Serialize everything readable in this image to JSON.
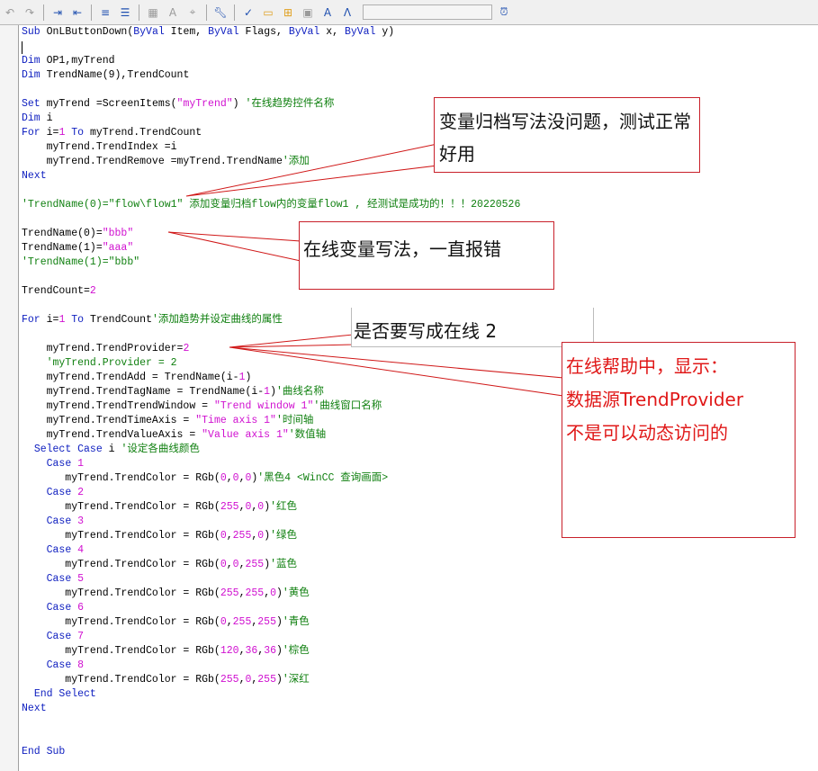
{
  "toolbar": {
    "icons": [
      "undo-icon",
      "redo-icon",
      "indent-icon",
      "outdent-icon",
      "align-icon",
      "comment-block-icon",
      "find-icon",
      "replace-icon",
      "goto-icon",
      "settings-icon",
      "check-syntax-icon",
      "folder-icon",
      "add-folder-icon",
      "tag-icon",
      "font-icon",
      "compass-icon",
      "clock-icon"
    ],
    "field_value": ""
  },
  "code": {
    "lines": [
      [
        [
          "k",
          "Sub"
        ],
        [
          "n",
          " OnLButtonDown("
        ],
        [
          "k",
          "ByVal"
        ],
        [
          "n",
          " Item, "
        ],
        [
          "k",
          "ByVal"
        ],
        [
          "n",
          " Flags, "
        ],
        [
          "k",
          "ByVal"
        ],
        [
          "n",
          " x, "
        ],
        [
          "k",
          "ByVal"
        ],
        [
          "n",
          " y)"
        ]
      ],
      [],
      [
        [
          "k",
          "Dim"
        ],
        [
          "n",
          " OP1,myTrend"
        ]
      ],
      [
        [
          "k",
          "Dim"
        ],
        [
          "n",
          " TrendName(9),TrendCount"
        ]
      ],
      [],
      [
        [
          "k",
          "Set"
        ],
        [
          "n",
          " myTrend =ScreenItems("
        ],
        [
          "s",
          "\"myTrend\""
        ],
        [
          "n",
          ") "
        ],
        [
          "c",
          "'在线趋势控件名称"
        ]
      ],
      [
        [
          "k",
          "Dim"
        ],
        [
          "n",
          " i"
        ]
      ],
      [
        [
          "k",
          "For"
        ],
        [
          "n",
          " i="
        ],
        [
          "s",
          "1"
        ],
        [
          "n",
          " "
        ],
        [
          "k",
          "To"
        ],
        [
          "n",
          " myTrend.TrendCount"
        ]
      ],
      [
        [
          "n",
          "    myTrend.TrendIndex =i"
        ]
      ],
      [
        [
          "n",
          "    myTrend.TrendRemove =myTrend.TrendName"
        ],
        [
          "c",
          "'添加"
        ]
      ],
      [
        [
          "k",
          "Next"
        ]
      ],
      [],
      [
        [
          "c",
          "'TrendName(0)=\"flow\\flow1\" 添加变量归档flow内的变量flow1 , 经测试是成功的！！！20220526"
        ]
      ],
      [],
      [
        [
          "n",
          "TrendName(0)="
        ],
        [
          "s",
          "\"bbb\""
        ]
      ],
      [
        [
          "n",
          "TrendName(1)="
        ],
        [
          "s",
          "\"aaa\""
        ]
      ],
      [
        [
          "c",
          "'TrendName(1)=\"bbb\""
        ]
      ],
      [],
      [
        [
          "n",
          "TrendCount="
        ],
        [
          "s",
          "2"
        ]
      ],
      [],
      [
        [
          "k",
          "For"
        ],
        [
          "n",
          " i="
        ],
        [
          "s",
          "1"
        ],
        [
          "n",
          " "
        ],
        [
          "k",
          "To"
        ],
        [
          "n",
          " TrendCount"
        ],
        [
          "c",
          "'添加趋势并设定曲线的属性"
        ]
      ],
      [],
      [
        [
          "n",
          "    myTrend.TrendProvider="
        ],
        [
          "s",
          "2"
        ]
      ],
      [
        [
          "c",
          "    'myTrend.Provider = 2"
        ]
      ],
      [
        [
          "n",
          "    myTrend.TrendAdd = TrendName(i-"
        ],
        [
          "s",
          "1"
        ],
        [
          "n",
          ")"
        ]
      ],
      [
        [
          "n",
          "    myTrend.TrendTagName = TrendName(i-"
        ],
        [
          "s",
          "1"
        ],
        [
          "n",
          ")"
        ],
        [
          "c",
          "'曲线名称"
        ]
      ],
      [
        [
          "n",
          "    myTrend.TrendTrendWindow = "
        ],
        [
          "s",
          "\"Trend window 1\""
        ],
        [
          "c",
          "'曲线窗口名称"
        ]
      ],
      [
        [
          "n",
          "    myTrend.TrendTimeAxis = "
        ],
        [
          "s",
          "\"Time axis 1\""
        ],
        [
          "c",
          "'时间轴"
        ]
      ],
      [
        [
          "n",
          "    myTrend.TrendValueAxis = "
        ],
        [
          "s",
          "\"Value axis 1\""
        ],
        [
          "c",
          "'数值轴"
        ]
      ],
      [
        [
          "n",
          "  "
        ],
        [
          "k",
          "Select Case"
        ],
        [
          "n",
          " i "
        ],
        [
          "c",
          "'设定各曲线颜色"
        ]
      ],
      [
        [
          "n",
          "    "
        ],
        [
          "k",
          "Case"
        ],
        [
          "n",
          " "
        ],
        [
          "s",
          "1"
        ]
      ],
      [
        [
          "n",
          "       myTrend.TrendColor = RGb("
        ],
        [
          "s",
          "0"
        ],
        [
          "n",
          ","
        ],
        [
          "s",
          "0"
        ],
        [
          "n",
          ","
        ],
        [
          "s",
          "0"
        ],
        [
          "n",
          ")"
        ],
        [
          "c",
          "'黑色4 <WinCC 查询画面>"
        ]
      ],
      [
        [
          "n",
          "    "
        ],
        [
          "k",
          "Case"
        ],
        [
          "n",
          " "
        ],
        [
          "s",
          "2"
        ]
      ],
      [
        [
          "n",
          "       myTrend.TrendColor = RGb("
        ],
        [
          "s",
          "255"
        ],
        [
          "n",
          ","
        ],
        [
          "s",
          "0"
        ],
        [
          "n",
          ","
        ],
        [
          "s",
          "0"
        ],
        [
          "n",
          ")"
        ],
        [
          "c",
          "'红色"
        ]
      ],
      [
        [
          "n",
          "    "
        ],
        [
          "k",
          "Case"
        ],
        [
          "n",
          " "
        ],
        [
          "s",
          "3"
        ]
      ],
      [
        [
          "n",
          "       myTrend.TrendColor = RGb("
        ],
        [
          "s",
          "0"
        ],
        [
          "n",
          ","
        ],
        [
          "s",
          "255"
        ],
        [
          "n",
          ","
        ],
        [
          "s",
          "0"
        ],
        [
          "n",
          ")"
        ],
        [
          "c",
          "'绿色"
        ]
      ],
      [
        [
          "n",
          "    "
        ],
        [
          "k",
          "Case"
        ],
        [
          "n",
          " "
        ],
        [
          "s",
          "4"
        ]
      ],
      [
        [
          "n",
          "       myTrend.TrendColor = RGb("
        ],
        [
          "s",
          "0"
        ],
        [
          "n",
          ","
        ],
        [
          "s",
          "0"
        ],
        [
          "n",
          ","
        ],
        [
          "s",
          "255"
        ],
        [
          "n",
          ")"
        ],
        [
          "c",
          "'蓝色"
        ]
      ],
      [
        [
          "n",
          "    "
        ],
        [
          "k",
          "Case"
        ],
        [
          "n",
          " "
        ],
        [
          "s",
          "5"
        ]
      ],
      [
        [
          "n",
          "       myTrend.TrendColor = RGb("
        ],
        [
          "s",
          "255"
        ],
        [
          "n",
          ","
        ],
        [
          "s",
          "255"
        ],
        [
          "n",
          ","
        ],
        [
          "s",
          "0"
        ],
        [
          "n",
          ")"
        ],
        [
          "c",
          "'黄色"
        ]
      ],
      [
        [
          "n",
          "    "
        ],
        [
          "k",
          "Case"
        ],
        [
          "n",
          " "
        ],
        [
          "s",
          "6"
        ]
      ],
      [
        [
          "n",
          "       myTrend.TrendColor = RGb("
        ],
        [
          "s",
          "0"
        ],
        [
          "n",
          ","
        ],
        [
          "s",
          "255"
        ],
        [
          "n",
          ","
        ],
        [
          "s",
          "255"
        ],
        [
          "n",
          ")"
        ],
        [
          "c",
          "'青色"
        ]
      ],
      [
        [
          "n",
          "    "
        ],
        [
          "k",
          "Case"
        ],
        [
          "n",
          " "
        ],
        [
          "s",
          "7"
        ]
      ],
      [
        [
          "n",
          "       myTrend.TrendColor = RGb("
        ],
        [
          "s",
          "120"
        ],
        [
          "n",
          ","
        ],
        [
          "s",
          "36"
        ],
        [
          "n",
          ","
        ],
        [
          "s",
          "36"
        ],
        [
          "n",
          ")"
        ],
        [
          "c",
          "'棕色"
        ]
      ],
      [
        [
          "n",
          "    "
        ],
        [
          "k",
          "Case"
        ],
        [
          "n",
          " "
        ],
        [
          "s",
          "8"
        ]
      ],
      [
        [
          "n",
          "       myTrend.TrendColor = RGb("
        ],
        [
          "s",
          "255"
        ],
        [
          "n",
          ","
        ],
        [
          "s",
          "0"
        ],
        [
          "n",
          ","
        ],
        [
          "s",
          "255"
        ],
        [
          "n",
          ")"
        ],
        [
          "c",
          "'深红"
        ]
      ],
      [
        [
          "n",
          "  "
        ],
        [
          "k",
          "End Select"
        ]
      ],
      [
        [
          "k",
          "Next"
        ]
      ],
      [],
      [],
      [
        [
          "k",
          "End Sub"
        ]
      ]
    ]
  },
  "callouts": {
    "archive_ok": "变量归档写法没问题，测试正常好用",
    "online_error": "在线变量写法，一直报错",
    "online_2": "是否要写成在线 2",
    "help_line1": "在线帮助中，显示：",
    "help_line2": "数据源TrendProvider",
    "help_line3": "不是可以动态访问的"
  },
  "colors": {
    "keyword": "#1020c0",
    "string": "#d010d0",
    "comment": "#108010",
    "callout_border": "#c8202a",
    "help_text": "#e01818"
  }
}
